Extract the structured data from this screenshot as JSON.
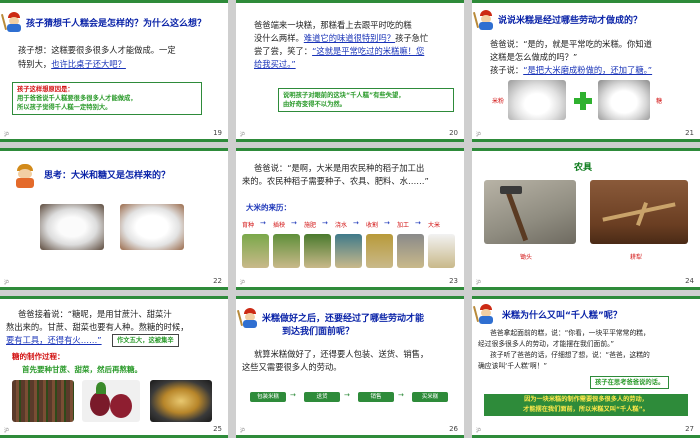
{
  "slides": {
    "s19": {
      "num": "19",
      "title": "孩子猜想千人糕会是怎样的？为什么这么想？",
      "line1": "孩子想：这糕要很多很多人才能做成。一定",
      "line2a": "特别大，",
      "line2b": "也许比桌子还大吧？",
      "box_h": "孩子这样想原因是：",
      "box_l1": "用于爸爸说千人糕要很多很多人才能做成，",
      "box_l2": "所以孩子觉得千人糕一定特别大。"
    },
    "s20": {
      "num": "20",
      "line1": "爸爸端来一块糕，那糕看上去跟平时吃的糕",
      "line2a": "没什么两样。",
      "line2b": "难道它的味道很特别吗？",
      "line2c": "孩子急忙",
      "line3a": "尝了尝，笑了：",
      "line3b": "“这就是平常吃过的米糕嘛！您",
      "line4": "给我买过。”",
      "box_l1": "说明孩子对眼前的这块“千人糕”有些失望，",
      "box_l2": "由好奇变得不以为然。"
    },
    "s21": {
      "num": "21",
      "title": "说说米糕是经过哪些劳动才做成的？",
      "line1": "爸爸说：“是的，就是平常吃的米糕。你知道",
      "line2": "这糕是怎么做成的吗？”",
      "line3a": "孩子说：",
      "line3b": "“是把大米磨成粉做的，还加了糖。”",
      "lbl_rice": "米粉",
      "lbl_sugar": "糖"
    },
    "s22": {
      "num": "22",
      "title": "思考：大米和糖又是怎样来的？"
    },
    "s23": {
      "num": "23",
      "line1": "爸爸说：“是啊，大米是用农民种的稻子加工出",
      "line2": "来的。农民种稻子需要种子、农具、肥料、水……”",
      "flow_title": "大米的来历：",
      "steps": [
        "育种",
        "插秧",
        "施肥",
        "浇水",
        "收割",
        "加工",
        "大米"
      ]
    },
    "s24": {
      "num": "24",
      "title": "农具",
      "lbl1": "锄头",
      "lbl2": "耕犁"
    },
    "s25": {
      "num": "25",
      "line1": "爸爸接着说：“糖呢，是用甘蔗汁、甜菜汁",
      "line2": "熬出来的。甘蔗、甜菜也要有人种。熬糖的时候，",
      "line3a": "要有工具，",
      "line3b": "还得有火……”",
      "badge": "作文五大，这被集辛",
      "flow_title": "糖的制作过程：",
      "flow_text": "首先要种甘蔗、甜菜，然后再熬糖。"
    },
    "s26": {
      "num": "26",
      "title1": "米糕做好之后，还要经过了哪些劳动才能",
      "title2": "到达我们面前呢？",
      "line1": "就算米糕做好了，还得要人包装、送货、销售，",
      "line2": "这些又需要很多人的劳动。",
      "btns": [
        "包装米糕",
        "送货",
        "销售",
        "买米糕"
      ]
    },
    "s27": {
      "num": "27",
      "title": "米糕为什么又叫“千人糕”呢？",
      "line1": "爸爸拿起面前的糕，说：“你看，一块平平常常的糕，",
      "line2": "经过很多很多人的劳动，才能摆在我们面前。”",
      "line3": "孩子听了爸爸的话，仔细想了想，说：“爸爸，这糕的",
      "line4": "确应该叫‘千人糕’啊！”",
      "note": "孩子在思考爸爸说的话。",
      "banner1": "因为一块米糕的制作需要很多很多人的劳动，",
      "banner2": "才能摆在我们面前，所以米糕又叫“千人糕”。"
    },
    "footer": "沪"
  }
}
